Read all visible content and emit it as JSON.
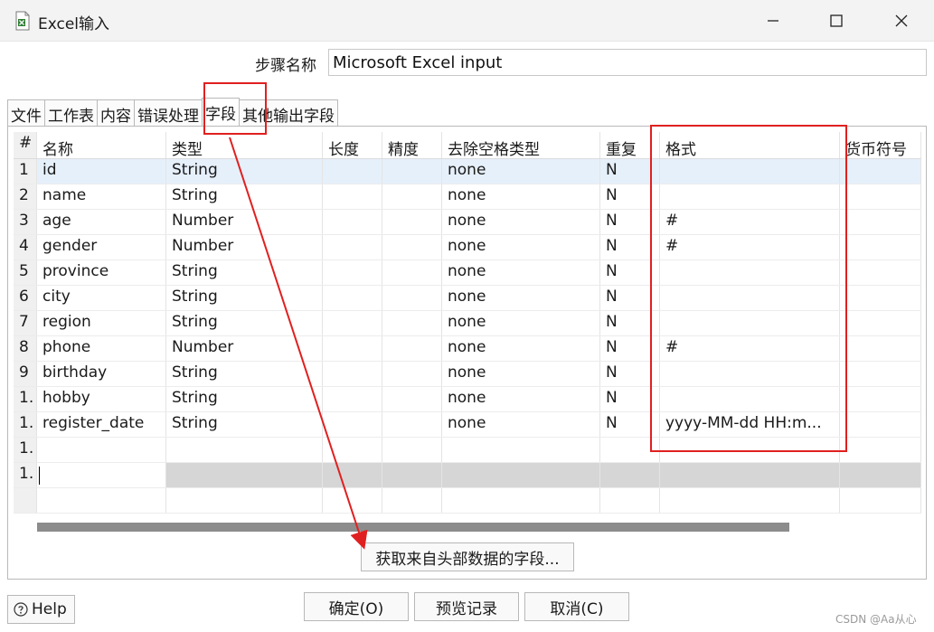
{
  "window": {
    "title": "Excel输入"
  },
  "step": {
    "label": "步骤名称",
    "value": "Microsoft Excel input"
  },
  "tabs": [
    "文件",
    "工作表",
    "内容",
    "错误处理",
    "字段",
    "其他输出字段"
  ],
  "active_tab": "字段",
  "table": {
    "columns": [
      "#",
      "名称",
      "类型",
      "长度",
      "精度",
      "去除空格类型",
      "重复",
      "格式",
      "货币符号"
    ],
    "rows": [
      {
        "n": "1",
        "name": "id",
        "type": "String",
        "length": "",
        "precision": "",
        "trim": "none",
        "repeat": "N",
        "format": "",
        "currency": ""
      },
      {
        "n": "2",
        "name": "name",
        "type": "String",
        "length": "",
        "precision": "",
        "trim": "none",
        "repeat": "N",
        "format": "",
        "currency": ""
      },
      {
        "n": "3",
        "name": "age",
        "type": "Number",
        "length": "",
        "precision": "",
        "trim": "none",
        "repeat": "N",
        "format": "#",
        "currency": ""
      },
      {
        "n": "4",
        "name": "gender",
        "type": "Number",
        "length": "",
        "precision": "",
        "trim": "none",
        "repeat": "N",
        "format": "#",
        "currency": ""
      },
      {
        "n": "5",
        "name": "province",
        "type": "String",
        "length": "",
        "precision": "",
        "trim": "none",
        "repeat": "N",
        "format": "",
        "currency": ""
      },
      {
        "n": "6",
        "name": "city",
        "type": "String",
        "length": "",
        "precision": "",
        "trim": "none",
        "repeat": "N",
        "format": "",
        "currency": ""
      },
      {
        "n": "7",
        "name": "region",
        "type": "String",
        "length": "",
        "precision": "",
        "trim": "none",
        "repeat": "N",
        "format": "",
        "currency": ""
      },
      {
        "n": "8",
        "name": "phone",
        "type": "Number",
        "length": "",
        "precision": "",
        "trim": "none",
        "repeat": "N",
        "format": "#",
        "currency": ""
      },
      {
        "n": "9",
        "name": "birthday",
        "type": "String",
        "length": "",
        "precision": "",
        "trim": "none",
        "repeat": "N",
        "format": "",
        "currency": ""
      },
      {
        "n": "1.",
        "name": "hobby",
        "type": "String",
        "length": "",
        "precision": "",
        "trim": "none",
        "repeat": "N",
        "format": "",
        "currency": ""
      },
      {
        "n": "1.",
        "name": "register_date",
        "type": "String",
        "length": "",
        "precision": "",
        "trim": "none",
        "repeat": "N",
        "format": "yyyy-MM-dd HH:m...",
        "currency": ""
      },
      {
        "n": "1.",
        "name": "",
        "type": "",
        "length": "",
        "precision": "",
        "trim": "",
        "repeat": "",
        "format": "",
        "currency": ""
      },
      {
        "n": "1.",
        "name": "",
        "type": "",
        "length": "",
        "precision": "",
        "trim": "",
        "repeat": "",
        "format": "",
        "currency": ""
      }
    ]
  },
  "buttons": {
    "get_fields": "获取来自头部数据的字段...",
    "help": "Help",
    "ok": "确定(O)",
    "preview": "预览记录",
    "cancel": "取消(C)"
  },
  "watermark": "CSDN @Aa从心",
  "colors": {
    "annotation": "#e02020",
    "selected_row": "#e6f0fb",
    "scrollbar": "#8c8c8c"
  }
}
